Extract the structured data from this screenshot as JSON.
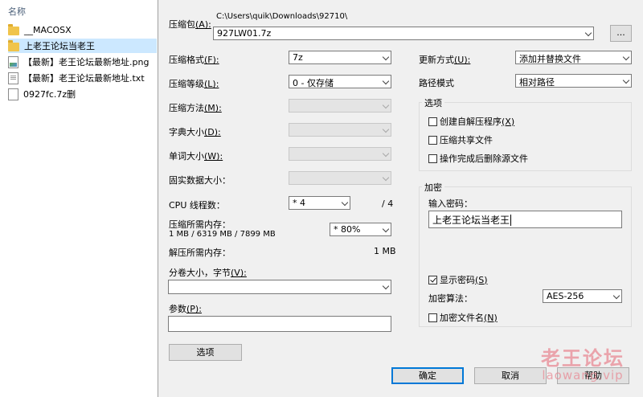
{
  "explorer": {
    "column_header": "名称",
    "files": [
      {
        "name": "__MACOSX",
        "icon": "folder-icon",
        "selected": false
      },
      {
        "name": "上老王论坛当老王",
        "icon": "folder-icon",
        "selected": true
      },
      {
        "name": "【最新】老王论坛最新地址.png",
        "icon": "image-file-icon",
        "selected": false
      },
      {
        "name": "【最新】老王论坛最新地址.txt",
        "icon": "text-file-icon",
        "selected": false
      },
      {
        "name": "0927fc.7z删",
        "icon": "blank-file-icon",
        "selected": false
      }
    ]
  },
  "dialog": {
    "archive_label": "压缩包",
    "archive_hotkey": "(A):",
    "archive_path": "C:\\Users\\quik\\Downloads\\92710\\",
    "archive_name": "927LW01.7z",
    "browse_label": "...",
    "left": {
      "format_label": "压缩格式",
      "format_hotkey": "(F):",
      "format_value": "7z",
      "level_label": "压缩等级",
      "level_hotkey": "(L):",
      "level_value": "0 - 仅存储",
      "method_label": "压缩方法",
      "method_hotkey": "(M):",
      "dict_label": "字典大小",
      "dict_hotkey": "(D):",
      "word_label": "单词大小",
      "word_hotkey": "(W):",
      "solid_label": "固实数据大小：",
      "cpu_label": "CPU 线程数：",
      "cpu_value": "* 4",
      "cpu_total": "/ 4",
      "mem_compress_label": "压缩所需内存：",
      "mem_compress_value": "1 MB / 6319 MB / 7899 MB",
      "mem_percent_value": "* 80%",
      "mem_decompress_label": "解压所需内存：",
      "mem_decompress_value": "1 MB",
      "split_label": "分卷大小，字节",
      "split_hotkey": "(V):",
      "params_label": "参数",
      "params_hotkey": "(P):",
      "options_button": "选项"
    },
    "right": {
      "update_label": "更新方式",
      "update_hotkey": "(U):",
      "update_value": "添加并替换文件",
      "path_label": "路径模式",
      "path_value": "相对路径",
      "options_group": "选项",
      "opt_sfx": "创建自解压程序",
      "opt_sfx_hotkey": "(X)",
      "opt_shared": "压缩共享文件",
      "opt_delete": "操作完成后删除源文件",
      "encrypt_group": "加密",
      "password_label": "输入密码：",
      "password_value": "上老王论坛当老王",
      "show_password": "显示密码",
      "show_password_hotkey": "(S)",
      "algo_label": "加密算法：",
      "algo_value": "AES-256",
      "encrypt_names": "加密文件名",
      "encrypt_names_hotkey": "(N)"
    },
    "buttons": {
      "ok": "确定",
      "cancel": "取消",
      "help": "帮助"
    }
  },
  "watermark": {
    "cn": "老王论坛",
    "en": "laowang.vip"
  },
  "colors": {
    "selection": "#cce8ff",
    "dialog_bg": "#f0f0f0",
    "accent": "#0078d7",
    "watermark": "#e88a94"
  }
}
